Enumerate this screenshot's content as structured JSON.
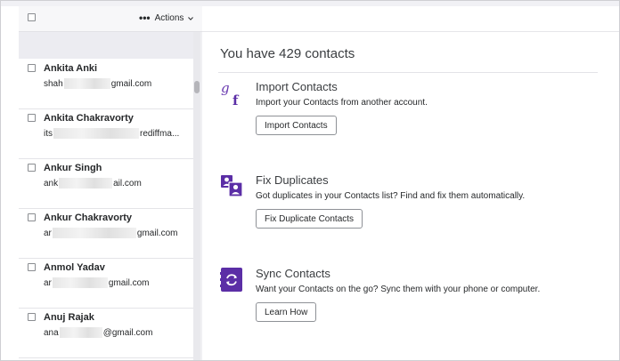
{
  "toolbar": {
    "actions_label": "Actions",
    "more_icon": "ellipsis-icon",
    "chevron_icon": "chevron-down-icon"
  },
  "contacts": [
    {
      "name": "Ankita Anki",
      "email_prefix": "shah",
      "email_suffix": "gmail.com"
    },
    {
      "name": "Ankita Chakravorty",
      "email_prefix": "its",
      "email_suffix": "rediffma..."
    },
    {
      "name": "Ankur Singh",
      "email_prefix": "ank",
      "email_suffix": "ail.com"
    },
    {
      "name": "Ankur Chakravorty",
      "email_prefix": "ar",
      "email_suffix": "gmail.com"
    },
    {
      "name": "Anmol Yadav",
      "email_prefix": "ar",
      "email_suffix": "gmail.com"
    },
    {
      "name": "Anuj Rajak",
      "email_prefix": "ana",
      "email_suffix": "@gmail.com"
    }
  ],
  "main": {
    "title": "You have 429 contacts",
    "sections": [
      {
        "icon": "google-facebook-import-icon",
        "title": "Import Contacts",
        "description": "Import your Contacts from another account.",
        "button": "Import Contacts"
      },
      {
        "icon": "fix-duplicates-icon",
        "title": "Fix Duplicates",
        "description": "Got duplicates in your Contacts list? Find and fix them automatically.",
        "button": "Fix Duplicate Contacts"
      },
      {
        "icon": "sync-contacts-icon",
        "title": "Sync Contacts",
        "description": "Want your Contacts on the go? Sync them with your phone or computer.",
        "button": "Learn How"
      }
    ]
  },
  "colors": {
    "accent_purple": "#5b2ea6",
    "google_purple": "#6a3bb0"
  }
}
